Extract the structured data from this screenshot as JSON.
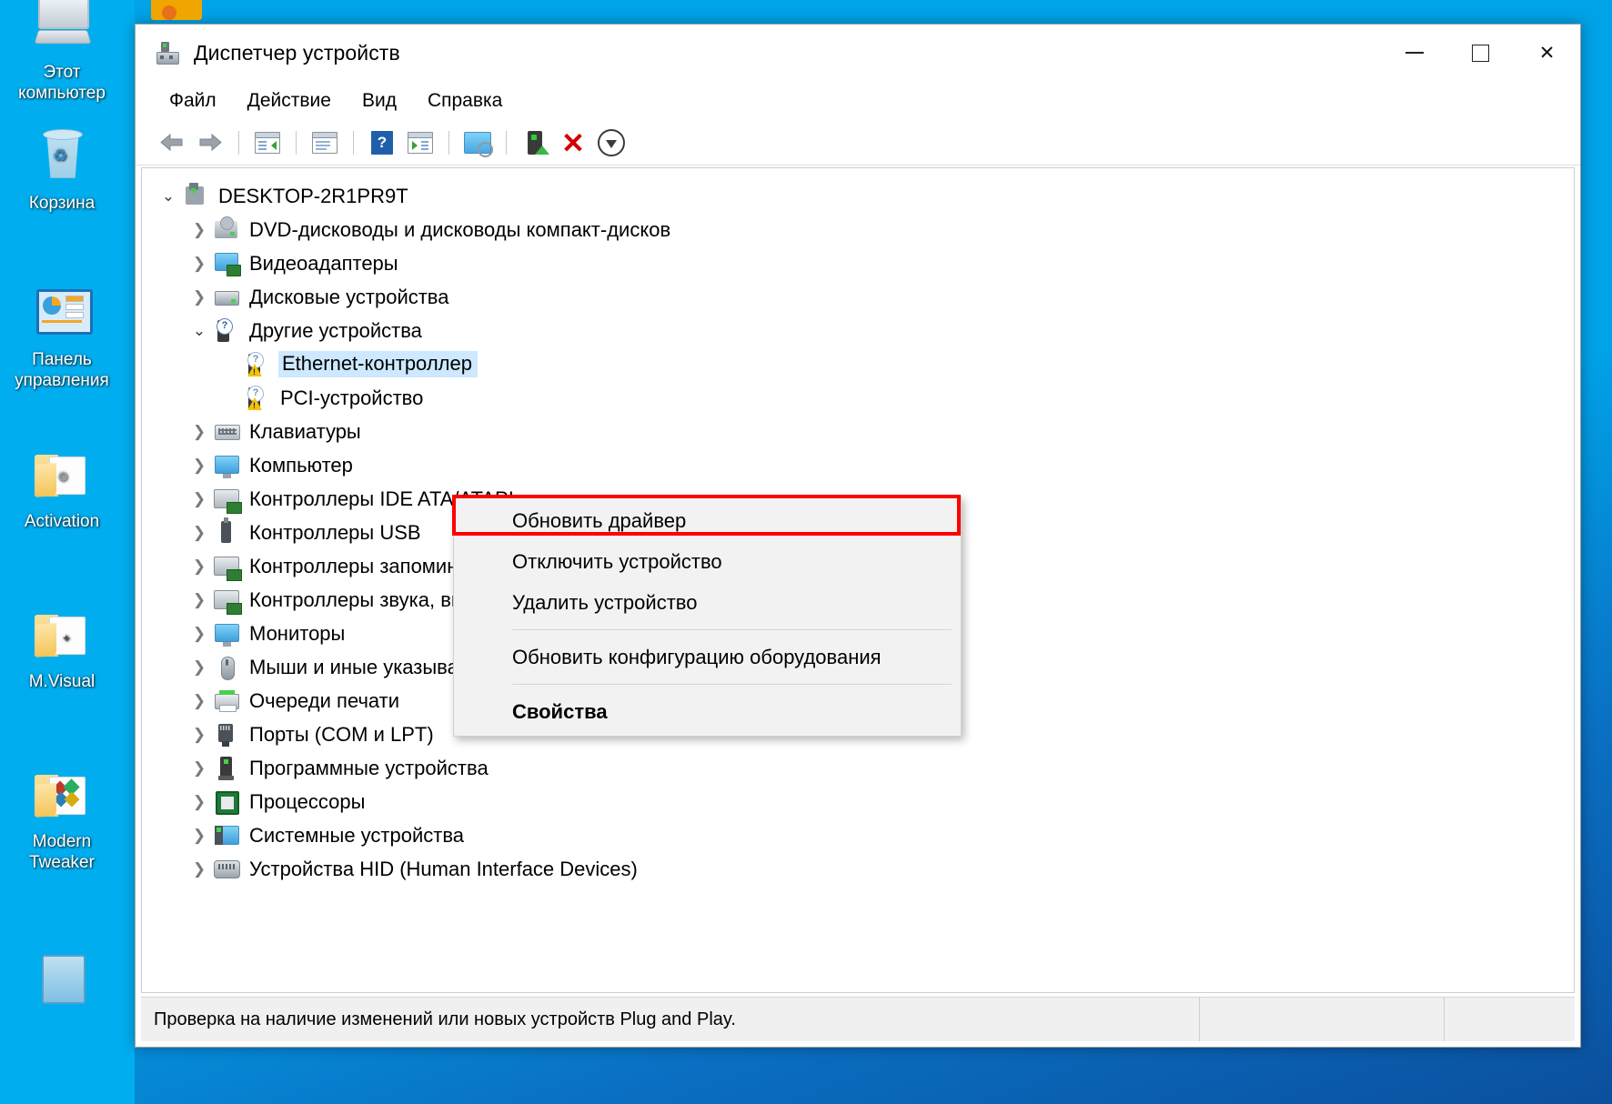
{
  "desktop": {
    "icons": [
      {
        "label_line1": "Этот",
        "label_line2": "компьютер",
        "icon": "this-pc-icon"
      },
      {
        "label_line1": "Корзина",
        "label_line2": "",
        "icon": "recycle-bin-icon"
      },
      {
        "label_line1": "Панель",
        "label_line2": "управления",
        "icon": "control-panel-icon"
      },
      {
        "label_line1": "Activation",
        "label_line2": "",
        "icon": "folder-icon"
      },
      {
        "label_line1": "M.Visual",
        "label_line2": "",
        "icon": "folder-icon"
      },
      {
        "label_line1": "Modern",
        "label_line2": "Tweaker",
        "icon": "folder-icon"
      }
    ]
  },
  "window": {
    "title": "Диспетчер устройств",
    "title_icon": "device-manager-icon",
    "controls": {
      "minimize": "−",
      "maximize": "□",
      "close": "✕"
    }
  },
  "menubar": {
    "items": [
      {
        "label": "Файл"
      },
      {
        "label": "Действие"
      },
      {
        "label": "Вид"
      },
      {
        "label": "Справка"
      }
    ]
  },
  "toolbar": {
    "buttons": [
      {
        "name": "back-arrow-icon"
      },
      {
        "name": "forward-arrow-icon"
      },
      {
        "name": "show-hide-console-tree-icon"
      },
      {
        "name": "properties-icon"
      },
      {
        "name": "help-icon"
      },
      {
        "name": "show-hide-action-pane-icon"
      },
      {
        "name": "scan-for-hardware-changes-icon"
      },
      {
        "name": "update-driver-icon"
      },
      {
        "name": "uninstall-device-icon"
      },
      {
        "name": "download-icon"
      }
    ]
  },
  "tree": {
    "root": {
      "label": "DESKTOP-2R1PR9T",
      "icon": "computer-icon",
      "expanded": true
    },
    "nodes": [
      {
        "label": "DVD-дисководы и дисководы компакт-дисков",
        "icon": "dvd-icon",
        "indent": 1,
        "expanded": false,
        "selected": false
      },
      {
        "label": "Видеоадаптеры",
        "icon": "video-icon",
        "indent": 1,
        "expanded": false,
        "selected": false
      },
      {
        "label": "Дисковые устройства",
        "icon": "disk-icon",
        "indent": 1,
        "expanded": false,
        "selected": false
      },
      {
        "label": "Другие устройства",
        "icon": "other-icon",
        "indent": 1,
        "expanded": true,
        "selected": false
      },
      {
        "label": "Ethernet-контроллер",
        "icon": "unknown-device-warning-icon",
        "indent": 2,
        "expanded": null,
        "selected": true
      },
      {
        "label": "PCI-устройство",
        "icon": "unknown-device-warning-icon",
        "indent": 2,
        "expanded": null,
        "selected": false
      },
      {
        "label": "Клавиатуры",
        "icon": "keyboard-icon",
        "indent": 1,
        "expanded": false,
        "selected": false
      },
      {
        "label": "Компьютер",
        "icon": "monitor-icon",
        "indent": 1,
        "expanded": false,
        "selected": false
      },
      {
        "label": "Контроллеры IDE ATA/ATAPI",
        "icon": "controller-icon",
        "indent": 1,
        "expanded": false,
        "selected": false
      },
      {
        "label": "Контроллеры USB",
        "icon": "usb-icon",
        "indent": 1,
        "expanded": false,
        "selected": false
      },
      {
        "label": "Контроллеры запоминающих устройств",
        "icon": "controller-icon",
        "indent": 1,
        "expanded": false,
        "selected": false
      },
      {
        "label": "Контроллеры звука, видео и игровых устройств",
        "icon": "sound-controller-icon",
        "indent": 1,
        "expanded": false,
        "selected": false
      },
      {
        "label": "Мониторы",
        "icon": "monitor-icon",
        "indent": 1,
        "expanded": false,
        "selected": false
      },
      {
        "label": "Мыши и иные указывающие устройства",
        "icon": "mouse-icon",
        "indent": 1,
        "expanded": false,
        "selected": false
      },
      {
        "label": "Очереди печати",
        "icon": "printer-icon",
        "indent": 1,
        "expanded": false,
        "selected": false
      },
      {
        "label": "Порты (COM и LPT)",
        "icon": "port-icon",
        "indent": 1,
        "expanded": false,
        "selected": false
      },
      {
        "label": "Программные устройства",
        "icon": "software-device-icon",
        "indent": 1,
        "expanded": false,
        "selected": false
      },
      {
        "label": "Процессоры",
        "icon": "cpu-icon",
        "indent": 1,
        "expanded": false,
        "selected": false
      },
      {
        "label": "Системные устройства",
        "icon": "system-device-icon",
        "indent": 1,
        "expanded": false,
        "selected": false
      },
      {
        "label": "Устройства HID (Human Interface Devices)",
        "icon": "hid-icon",
        "indent": 1,
        "expanded": false,
        "selected": false
      }
    ]
  },
  "context_menu": {
    "items": [
      {
        "label": "Обновить драйвер",
        "bold": false,
        "separator_after": false,
        "highlighted": true
      },
      {
        "label": "Отключить устройство",
        "bold": false,
        "separator_after": false,
        "highlighted": false
      },
      {
        "label": "Удалить устройство",
        "bold": false,
        "separator_after": true,
        "highlighted": false
      },
      {
        "label": "Обновить конфигурацию оборудования",
        "bold": false,
        "separator_after": true,
        "highlighted": false
      },
      {
        "label": "Свойства",
        "bold": true,
        "separator_after": false,
        "highlighted": false
      }
    ],
    "highlight_color": "#ff0000"
  },
  "statusbar": {
    "message": "Проверка на наличие изменений или новых устройств Plug and Play.",
    "pane2": "",
    "pane3": ""
  },
  "colors": {
    "desktop_blue": "#00aeef",
    "selection_blue": "#cde8ff",
    "menu_bg": "#f2f2f2",
    "accent_red": "#ff0000"
  }
}
